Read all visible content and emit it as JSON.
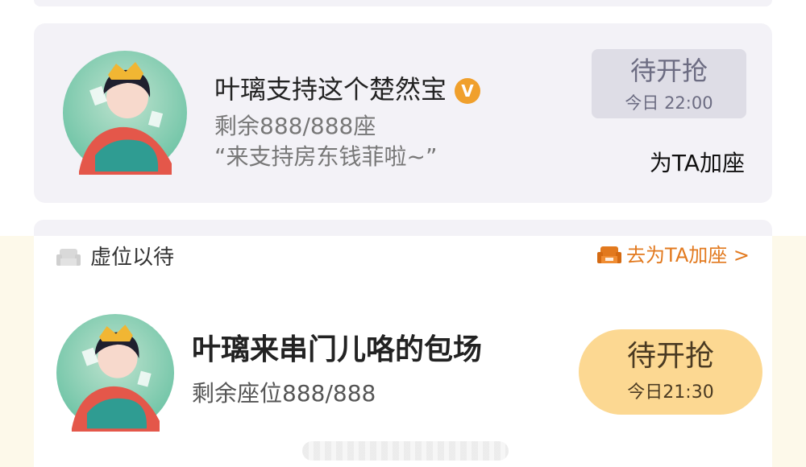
{
  "card1": {
    "title": "叶璃支持这个楚然宝",
    "verified_icon": "verified-v-icon",
    "badge_letter": "V",
    "remaining": "剩余888/888座",
    "quote": "“来支持房东钱菲啦~”",
    "button_main": "待开抢",
    "button_time": "今日 22:00",
    "add_seat": "为TA加座"
  },
  "card2": {
    "vacant_label": "虚位以待",
    "go_add": "去为TA加座 >",
    "title": "叶璃来串门儿咯的包场",
    "remaining": "剩余座位888/888",
    "button_main": "待开抢",
    "button_time": "今日21:30"
  },
  "colors": {
    "card_bg": "#f3f2f7",
    "button_gray": "#dedde6",
    "button_yellow": "#fcd892",
    "accent_orange": "#e2791e",
    "badge_orange": "#f0a02c",
    "band_bg": "#fdf9ea"
  }
}
